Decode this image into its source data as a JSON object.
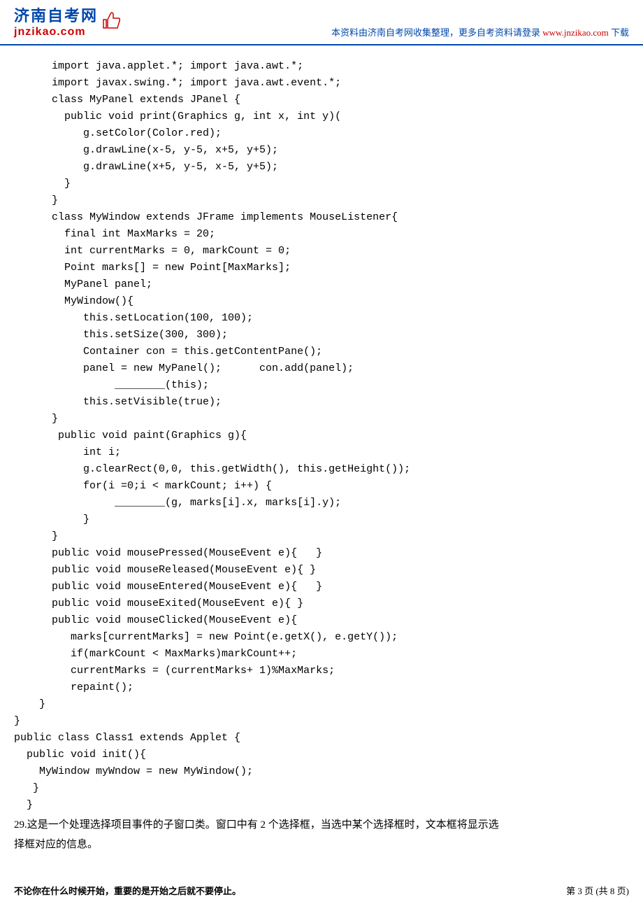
{
  "header": {
    "logo_main": "济南自考网",
    "logo_sub": "jnzikao.com",
    "note_prefix": "本资料由济南自考网收集整理，更多自考资料请登录 ",
    "note_url": "www.jnzikao.com",
    "note_suffix": " 下载"
  },
  "code": {
    "l01": "      import java.applet.*; import java.awt.*;",
    "l02": "      import javax.swing.*; import java.awt.event.*;",
    "l03": "      class MyPanel extends JPanel {",
    "l04": "        public void print(Graphics g, int x, int y)(",
    "l05": "           g.setColor(Color.red);",
    "l06": "           g.drawLine(x-5, y-5, x+5, y+5);",
    "l07": "           g.drawLine(x+5, y-5, x-5, y+5);",
    "l08": "        }",
    "l09": "      }",
    "l10": "      class MyWindow extends JFrame implements MouseListener{",
    "l11": "        final int MaxMarks = 20;",
    "l12": "        int currentMarks = 0, markCount = 0;",
    "l13": "        Point marks[] = new Point[MaxMarks];",
    "l14": "        MyPanel panel;",
    "l15": "        MyWindow(){",
    "l16": "           this.setLocation(100, 100);",
    "l17": "           this.setSize(300, 300);",
    "l18": "           Container con = this.getContentPane();",
    "l19": "           panel = new MyPanel();      con.add(panel);",
    "l20": "                ________(this);",
    "l21": "           this.setVisible(true);",
    "l22": "      }",
    "l23": "       public void paint(Graphics g){",
    "l24": "           int i;",
    "l25": "           g.clearRect(0,0, this.getWidth(), this.getHeight());",
    "l26": "           for(i =0;i < markCount; i++) {",
    "l27": "                ________(g, marks[i].x, marks[i].y);",
    "l28": "           }",
    "l29": "      }",
    "l30": "      public void mousePressed(MouseEvent e){   }",
    "l31": "      public void mouseReleased(MouseEvent e){ }",
    "l32": "      public void mouseEntered(MouseEvent e){   }",
    "l33": "      public void mouseExited(MouseEvent e){ }",
    "l34": "      public void mouseClicked(MouseEvent e){",
    "l35": "         marks[currentMarks] = new Point(e.getX(), e.getY());",
    "l36": "         if(markCount < MaxMarks)markCount++;",
    "l37": "         currentMarks = (currentMarks+ 1)%MaxMarks;",
    "l38": "         repaint();",
    "l39": "    }",
    "l40": "}",
    "l41": "public class Class1 extends Applet {",
    "l42": "  public void init(){",
    "l43": "    MyWindow myWndow = new MyWindow();",
    "l44": "   }",
    "l45": "  }"
  },
  "question": {
    "line1": "29.这是一个处理选择项目事件的子窗口类。窗口中有 2 个选择框，当选中某个选择框时，文本框将显示选",
    "line2": "   择框对应的信息。"
  },
  "footer": {
    "left": "不论你在什么时候开始，重要的是开始之后就不要停止。",
    "right": "第 3 页 (共 8 页)"
  }
}
